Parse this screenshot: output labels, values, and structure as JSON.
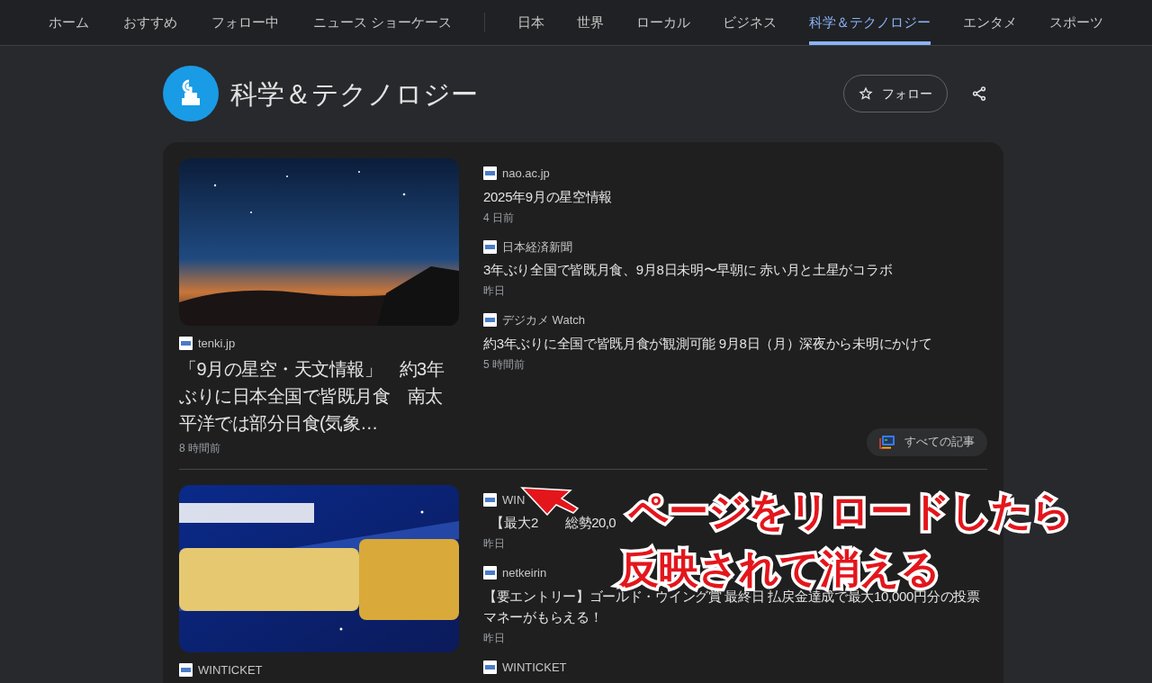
{
  "nav": {
    "tabs_primary": [
      {
        "label": "ホーム",
        "selected": false
      },
      {
        "label": "おすすめ",
        "selected": false
      },
      {
        "label": "フォロー中",
        "selected": false
      },
      {
        "label": "ニュース ショーケース",
        "selected": false
      }
    ],
    "tabs_sections": [
      {
        "label": "日本",
        "selected": false
      },
      {
        "label": "世界",
        "selected": false
      },
      {
        "label": "ローカル",
        "selected": false
      },
      {
        "label": "ビジネス",
        "selected": false
      },
      {
        "label": "科学＆テクノロジー",
        "selected": true
      },
      {
        "label": "エンタメ",
        "selected": false
      },
      {
        "label": "スポーツ",
        "selected": false
      }
    ]
  },
  "topic": {
    "title": "科学＆テクノロジー",
    "follow_button": "フォロー"
  },
  "story_groups": [
    {
      "featured": {
        "source": "tenki.jp",
        "title": "「9月の星空・天文情報」　約3年ぶりに日本全国で皆既月食　南太平洋では部分日食(気象…",
        "time": "8 時間前"
      },
      "articles": [
        {
          "source": "nao.ac.jp",
          "title": "2025年9月の星空情報",
          "time": "4 日前"
        },
        {
          "source": "日本経済新聞",
          "title": "3年ぶり全国で皆既月食、9月8日未明〜早朝に 赤い月と土星がコラボ",
          "time": "昨日"
        },
        {
          "source": "デジカメ Watch",
          "title": "約3年ぶりに全国で皆既月食が観測可能 9月8日（月）深夜から未明にかけて",
          "time": "5 時間前"
        }
      ],
      "all_articles_button": "すべての記事"
    },
    {
      "featured": {
        "source": "WINTICKET"
      },
      "articles": [
        {
          "source": "WIN",
          "title_parts": [
            "【最大2",
            "総勢20,0"
          ],
          "time": "昨日"
        },
        {
          "source": "netkeirin",
          "title": "【要エントリー】ゴールド・ウイング賞 最終日 払戻金達成で最大10,000円分の投票マネーがもらえる！",
          "time": "昨日"
        },
        {
          "source": "WINTICKET"
        }
      ]
    }
  ],
  "annotation": {
    "lines": [
      "ページをリロードしたら",
      "反映されて消える"
    ]
  }
}
